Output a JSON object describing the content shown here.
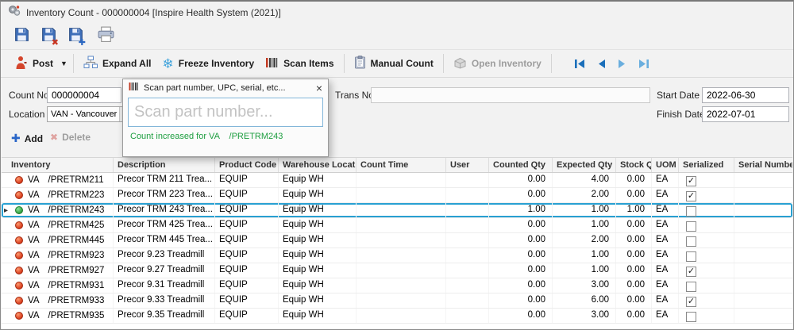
{
  "window": {
    "title": "Inventory Count - 000000004 [Inspire Health System (2021)]",
    "app_icon": "gears-icon"
  },
  "file_toolbar": {
    "buttons": [
      {
        "icon": "save-icon"
      },
      {
        "icon": "save-discard-icon"
      },
      {
        "icon": "save-new-icon"
      },
      {
        "icon": "print-icon"
      }
    ]
  },
  "action_toolbar": {
    "post": {
      "label": "Post",
      "icon": "post-person-icon",
      "has_dropdown": true
    },
    "expand_all": {
      "label": "Expand All",
      "icon": "expand-tree-icon"
    },
    "freeze": {
      "label": "Freeze Inventory",
      "icon": "snowflake-icon"
    },
    "scan": {
      "label": "Scan Items",
      "icon": "barcode-icon"
    },
    "manual": {
      "label": "Manual Count",
      "icon": "clipboard-icon"
    },
    "open_inventory": {
      "label": "Open Inventory",
      "icon": "open-box-icon",
      "disabled": true
    },
    "nav": {
      "first": "first-record-icon",
      "prev": "previous-record-icon",
      "next": "next-record-icon",
      "last": "last-record-icon"
    }
  },
  "form": {
    "count_no": {
      "label": "Count No",
      "value": "000000004"
    },
    "location": {
      "label": "Location",
      "value": "VAN - Vancouver"
    },
    "trans_no": {
      "label": "Trans No",
      "value": ""
    },
    "start_date": {
      "label": "Start Date",
      "value": "2022-06-30"
    },
    "finish_date": {
      "label": "Finish Date",
      "value": "2022-07-01"
    },
    "add_button": "Add",
    "delete_button": "Delete"
  },
  "scan_dialog": {
    "title": "Scan part number, UPC, serial, etc...",
    "placeholder": "Scan part number...",
    "message": "Count increased for VA    /PRETRM243"
  },
  "table": {
    "columns": [
      "Inventory",
      "Description",
      "Product Code",
      "Warehouse Location",
      "Count Time",
      "User",
      "Counted Qty",
      "Expected Qty",
      "Stock Qty",
      "UOM",
      "Serialized",
      "Serial Number"
    ],
    "rows": [
      {
        "status": "red",
        "whse": "VA",
        "part": "/PRETRM211",
        "description": "Precor TRM 211 Trea...",
        "product_code": "EQUIP",
        "warehouse_location": "Equip WH",
        "count_time": "",
        "user": "",
        "counted_qty": "0.00",
        "expected_qty": "4.00",
        "stock_qty": "0.00",
        "uom": "EA",
        "serialized": true,
        "serial_number": "",
        "selected": false
      },
      {
        "status": "red",
        "whse": "VA",
        "part": "/PRETRM223",
        "description": "Precor TRM 223 Trea...",
        "product_code": "EQUIP",
        "warehouse_location": "Equip WH",
        "count_time": "",
        "user": "",
        "counted_qty": "0.00",
        "expected_qty": "2.00",
        "stock_qty": "0.00",
        "uom": "EA",
        "serialized": true,
        "serial_number": "",
        "selected": false
      },
      {
        "status": "green",
        "whse": "VA",
        "part": "/PRETRM243",
        "description": "Precor TRM 243 Trea...",
        "product_code": "EQUIP",
        "warehouse_location": "Equip WH",
        "count_time": "",
        "user": "",
        "counted_qty": "1.00",
        "expected_qty": "1.00",
        "stock_qty": "1.00",
        "uom": "EA",
        "serialized": false,
        "serial_number": "",
        "selected": true
      },
      {
        "status": "red",
        "whse": "VA",
        "part": "/PRETRM425",
        "description": "Precor TRM 425 Trea...",
        "product_code": "EQUIP",
        "warehouse_location": "Equip WH",
        "count_time": "",
        "user": "",
        "counted_qty": "0.00",
        "expected_qty": "1.00",
        "stock_qty": "0.00",
        "uom": "EA",
        "serialized": false,
        "serial_number": "",
        "selected": false
      },
      {
        "status": "red",
        "whse": "VA",
        "part": "/PRETRM445",
        "description": "Precor TRM 445 Trea...",
        "product_code": "EQUIP",
        "warehouse_location": "Equip WH",
        "count_time": "",
        "user": "",
        "counted_qty": "0.00",
        "expected_qty": "2.00",
        "stock_qty": "0.00",
        "uom": "EA",
        "serialized": false,
        "serial_number": "",
        "selected": false
      },
      {
        "status": "red",
        "whse": "VA",
        "part": "/PRETRM923",
        "description": "Precor 9.23 Treadmill",
        "product_code": "EQUIP",
        "warehouse_location": "Equip WH",
        "count_time": "",
        "user": "",
        "counted_qty": "0.00",
        "expected_qty": "1.00",
        "stock_qty": "0.00",
        "uom": "EA",
        "serialized": false,
        "serial_number": "",
        "selected": false
      },
      {
        "status": "red",
        "whse": "VA",
        "part": "/PRETRM927",
        "description": "Precor 9.27 Treadmill",
        "product_code": "EQUIP",
        "warehouse_location": "Equip WH",
        "count_time": "",
        "user": "",
        "counted_qty": "0.00",
        "expected_qty": "1.00",
        "stock_qty": "0.00",
        "uom": "EA",
        "serialized": true,
        "serial_number": "",
        "selected": false
      },
      {
        "status": "red",
        "whse": "VA",
        "part": "/PRETRM931",
        "description": "Precor 9.31 Treadmill",
        "product_code": "EQUIP",
        "warehouse_location": "Equip WH",
        "count_time": "",
        "user": "",
        "counted_qty": "0.00",
        "expected_qty": "3.00",
        "stock_qty": "0.00",
        "uom": "EA",
        "serialized": false,
        "serial_number": "",
        "selected": false
      },
      {
        "status": "red",
        "whse": "VA",
        "part": "/PRETRM933",
        "description": "Precor 9.33 Treadmill",
        "product_code": "EQUIP",
        "warehouse_location": "Equip WH",
        "count_time": "",
        "user": "",
        "counted_qty": "0.00",
        "expected_qty": "6.00",
        "stock_qty": "0.00",
        "uom": "EA",
        "serialized": true,
        "serial_number": "",
        "selected": false
      },
      {
        "status": "red",
        "whse": "VA",
        "part": "/PRETRM935",
        "description": "Precor 9.35 Treadmill",
        "product_code": "EQUIP",
        "warehouse_location": "Equip WH",
        "count_time": "",
        "user": "",
        "counted_qty": "0.00",
        "expected_qty": "3.00",
        "stock_qty": "0.00",
        "uom": "EA",
        "serialized": false,
        "serial_number": "",
        "selected": false
      }
    ]
  },
  "colors": {
    "selection_border": "#28a0d2",
    "status_red": "#d63a1c",
    "status_green": "#2f9e3e",
    "nav_blue": "#1b6fba",
    "message_green": "#1e9e40"
  }
}
